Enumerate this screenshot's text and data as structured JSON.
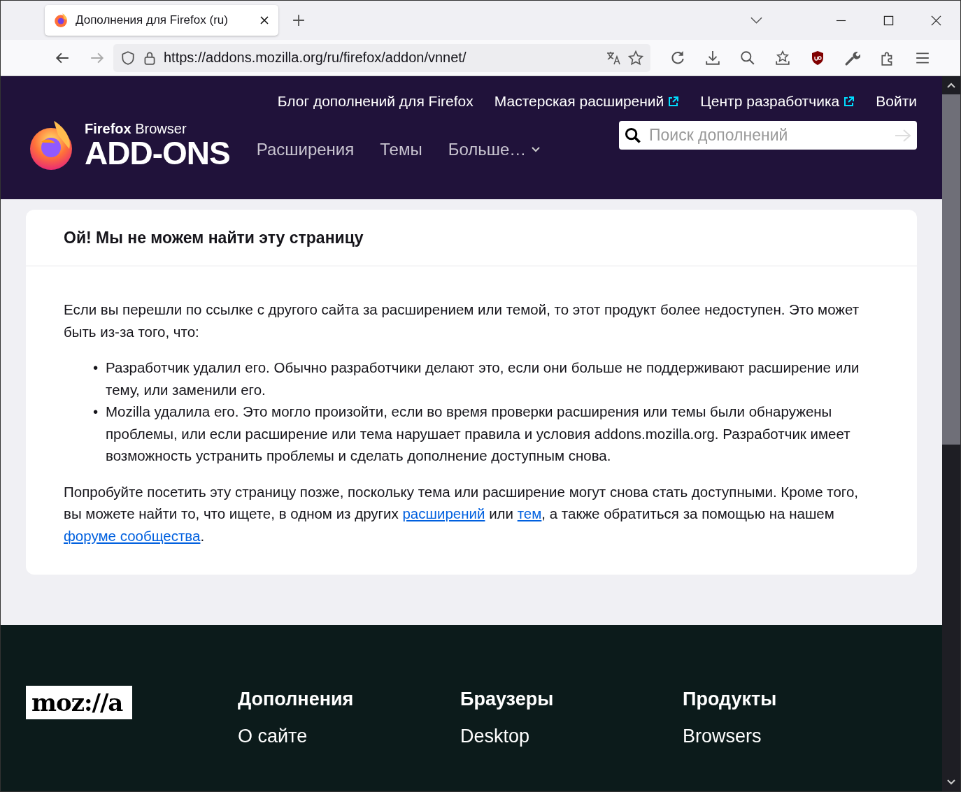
{
  "browser": {
    "tab": {
      "title": "Дополнения для Firefox (ru)",
      "selected": true
    },
    "url": "https://addons.mozilla.org/ru/firefox/addon/vnnet/"
  },
  "header": {
    "top_links": [
      {
        "label": "Блог дополнений для Firefox",
        "external": false
      },
      {
        "label": "Мастерская расширений",
        "external": true
      },
      {
        "label": "Центр разработчика",
        "external": true
      },
      {
        "label": "Войти",
        "external": false
      }
    ],
    "logo": {
      "brand": "Firefox",
      "product": "Browser",
      "title": "ADD-ONS"
    },
    "nav": [
      {
        "label": "Расширения",
        "dropdown": false
      },
      {
        "label": "Темы",
        "dropdown": false
      },
      {
        "label": "Больше…",
        "dropdown": true
      }
    ],
    "search": {
      "placeholder": "Поиск дополнений"
    }
  },
  "card": {
    "title": "Ой! Мы не можем найти эту страницу",
    "intro": "Если вы перешли по ссылке с другого сайта за расширением или темой, то этот продукт более недоступен. Это может быть из-за того, что:",
    "bullets": [
      {
        "marker": "•",
        "text": "Разработчик удалил его. Обычно разработчики делают это, если они больше не поддерживают расширение или тему, или заменили его."
      },
      {
        "marker": "•",
        "text": "Mozilla удалила его. Это могло произойти, если во время проверки расширения или темы были обнаружены проблемы, или если расширение или тема нарушает правила и условия addons.mozilla.org. Разработчик имеет возможность устранить проблемы и сделать дополнение доступным снова."
      }
    ],
    "closing": [
      {
        "kind": "text",
        "text": "Попробуйте посетить эту страницу позже, поскольку тема или расширение могут снова стать доступными. Кроме того, вы можете найти то, что ищете, в одном из других "
      },
      {
        "kind": "link",
        "text": "расширений"
      },
      {
        "kind": "text",
        "text": " или "
      },
      {
        "kind": "link",
        "text": "тем"
      },
      {
        "kind": "text",
        "text": ", а также обратиться за помощью на нашем "
      },
      {
        "kind": "link",
        "text": "форуме сообщества"
      },
      {
        "kind": "text",
        "text": "."
      }
    ]
  },
  "footer": {
    "logo": "moz://a",
    "columns": [
      {
        "heading": "Дополнения",
        "links": [
          "О сайте"
        ]
      },
      {
        "heading": "Браузеры",
        "links": [
          "Desktop"
        ]
      },
      {
        "heading": "Продукты",
        "links": [
          "Browsers"
        ]
      }
    ]
  }
}
